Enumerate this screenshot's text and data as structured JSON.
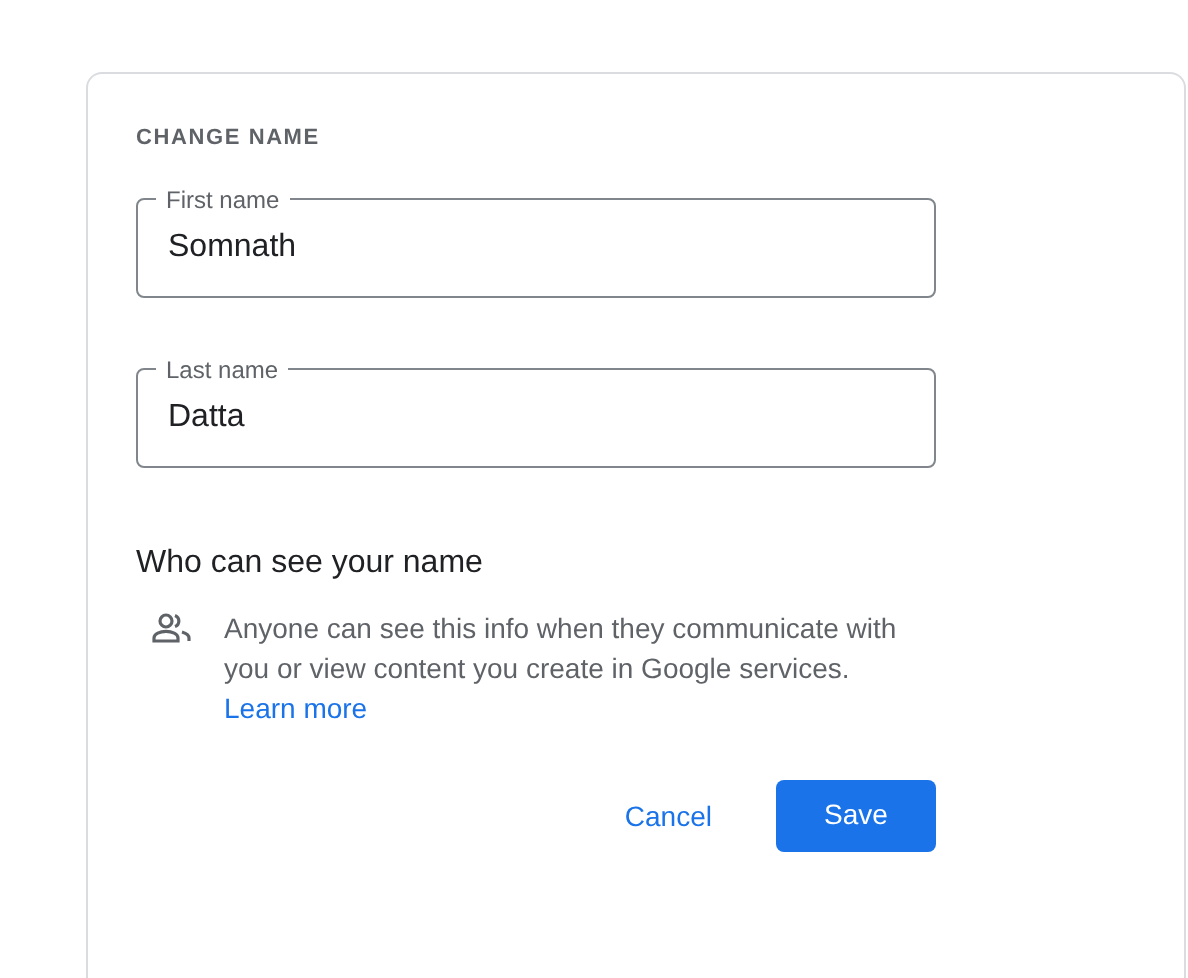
{
  "section_title": "CHANGE NAME",
  "fields": [
    {
      "label": "First name",
      "value": "Somnath"
    },
    {
      "label": "Last name",
      "value": "Datta"
    }
  ],
  "visibility": {
    "heading": "Who can see your name",
    "text": "Anyone can see this info when they communicate with you or view content you create in Google services.",
    "link": "Learn more"
  },
  "buttons": [
    {
      "label": "Cancel",
      "kind": "text"
    },
    {
      "label": "Save",
      "kind": "filled"
    }
  ]
}
